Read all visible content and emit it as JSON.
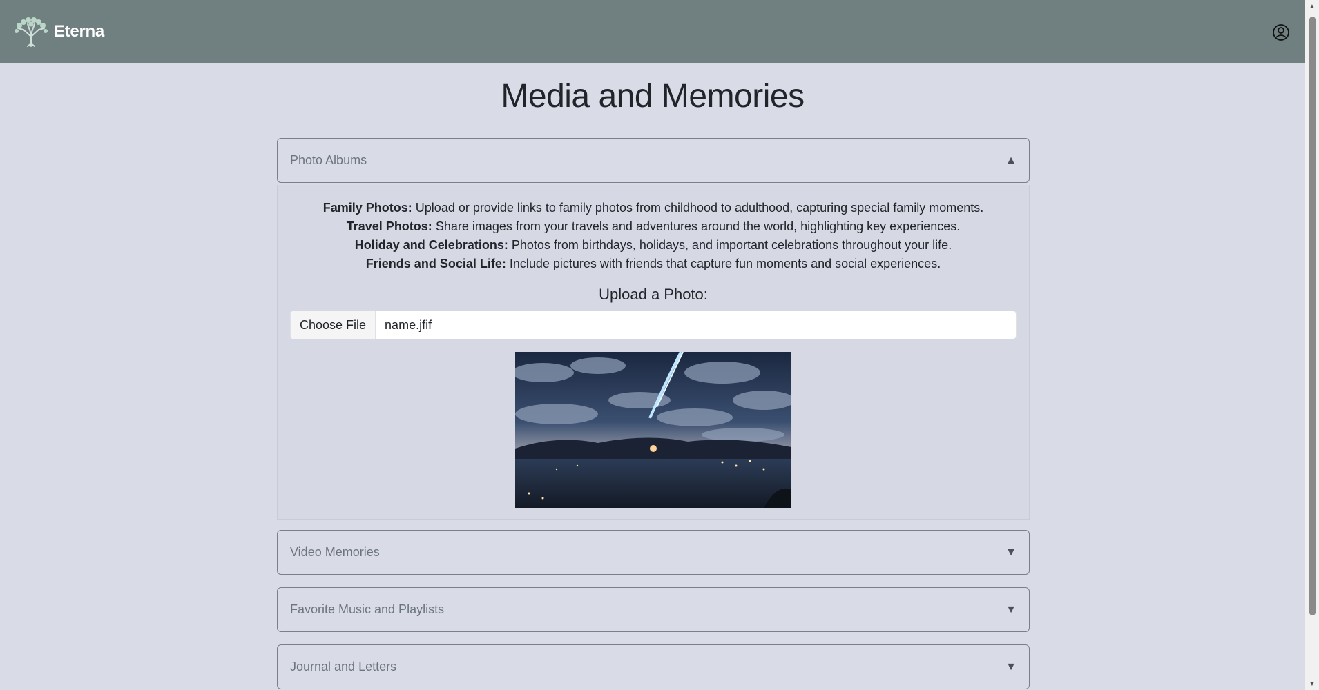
{
  "header": {
    "brand_name": "Eterna",
    "logo_icon": "tree-logo-icon",
    "user_icon": "user-circle-icon",
    "background_color": "#707f7f"
  },
  "page": {
    "title": "Media and Memories"
  },
  "sections": {
    "photo_albums": {
      "title": "Photo Albums",
      "state_icon": "triangle-up-icon",
      "expanded": true,
      "items": [
        {
          "label": "Family Photos:",
          "text": "Upload or provide links to family photos from childhood to adulthood, capturing special family moments."
        },
        {
          "label": "Travel Photos:",
          "text": "Share images from your travels and adventures around the world, highlighting key experiences."
        },
        {
          "label": "Holiday and Celebrations:",
          "text": "Photos from birthdays, holidays, and important celebrations throughout your life."
        },
        {
          "label": "Friends and Social Life:",
          "text": "Include pictures with friends that capture fun moments and social experiences."
        }
      ],
      "upload": {
        "label": "Upload a Photo:",
        "button_label": "Choose File",
        "file_name": "name.jfif"
      }
    },
    "video_memories": {
      "title": "Video Memories",
      "state_icon": "triangle-down-icon",
      "expanded": false
    },
    "music": {
      "title": "Favorite Music and Playlists",
      "state_icon": "triangle-down-icon",
      "expanded": false
    },
    "journal": {
      "title": "Journal and Letters",
      "state_icon": "triangle-down-icon",
      "expanded": false
    }
  },
  "icons": {
    "caret_up": "▲",
    "caret_down": "▼"
  }
}
